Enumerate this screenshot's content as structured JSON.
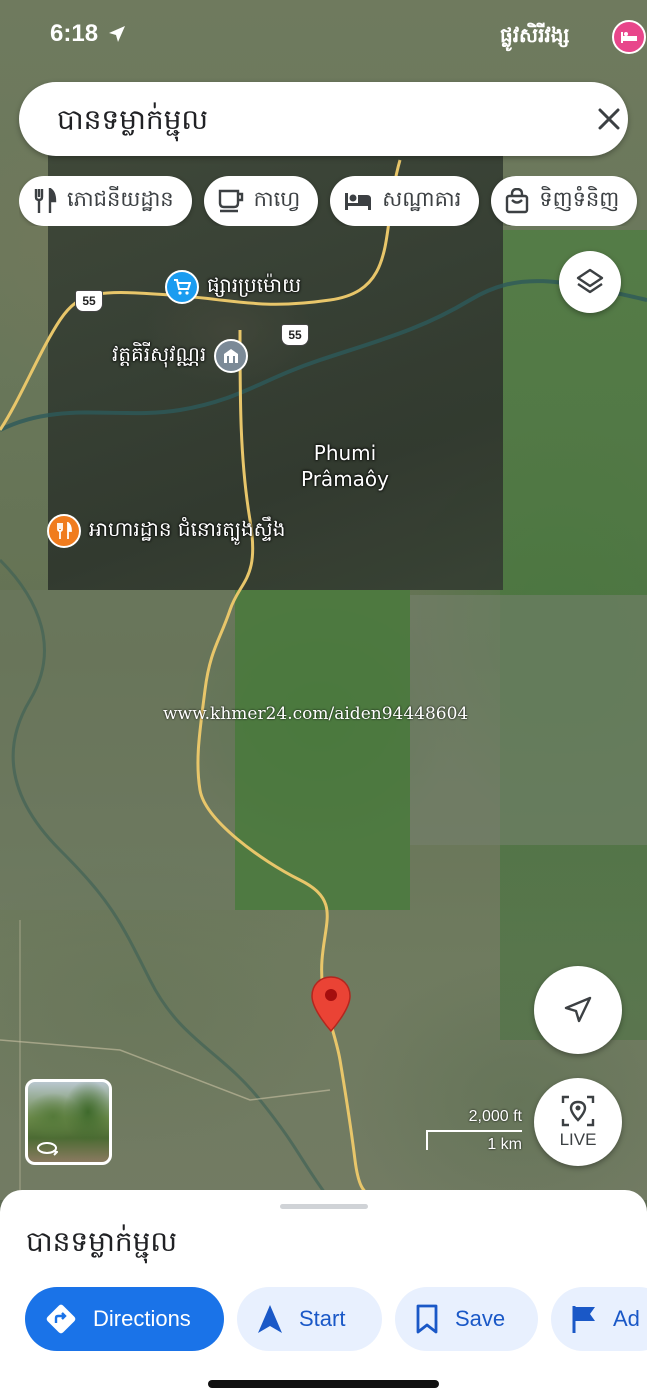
{
  "status_bar": {
    "time": "6:18",
    "right_text": "ផ្លូវសិរីវង្ស"
  },
  "search": {
    "query": "បានទម្លាក់ម្ជុល"
  },
  "chips": [
    {
      "label": "ភោជនីយដ្ឋាន",
      "icon": "restaurant-icon"
    },
    {
      "label": "កាហ្វេ",
      "icon": "coffee-icon"
    },
    {
      "label": "សណ្ឋាគារ",
      "icon": "hotel-icon"
    },
    {
      "label": "ទិញទំនិញ",
      "icon": "shopping-bag-icon"
    }
  ],
  "map": {
    "road_shield_1": "55",
    "road_shield_2": "55",
    "poi_market": "ផ្សារប្រម៉ោយ",
    "poi_pagoda": "វត្តគិរីសុវណ្ណរ",
    "place_name_line1": "Phumi",
    "place_name_line2": "Prâmaôy",
    "poi_restaurant": "អាហារដ្ឋាន ជំនោរត្បូងស្ទឹង",
    "watermark": "www.khmer24.com/aiden94448604",
    "scale_ft": "2,000 ft",
    "scale_km": "1 km",
    "live_label": "LIVE",
    "colors": {
      "pin": "#ea4335",
      "market_poi": "#1a9cf0",
      "pagoda_poi": "#7b8a97",
      "restaurant_poi": "#f07c1e",
      "road": "#e8c66a"
    }
  },
  "sheet": {
    "title": "បានទម្លាក់ម្ជុល",
    "actions": [
      {
        "label": "Directions",
        "icon": "directions-icon"
      },
      {
        "label": "Start",
        "icon": "navigation-arrow-icon"
      },
      {
        "label": "Save",
        "icon": "bookmark-icon"
      },
      {
        "label": "Ad",
        "icon": "flag-icon"
      }
    ],
    "accent": "#1a73e8"
  }
}
